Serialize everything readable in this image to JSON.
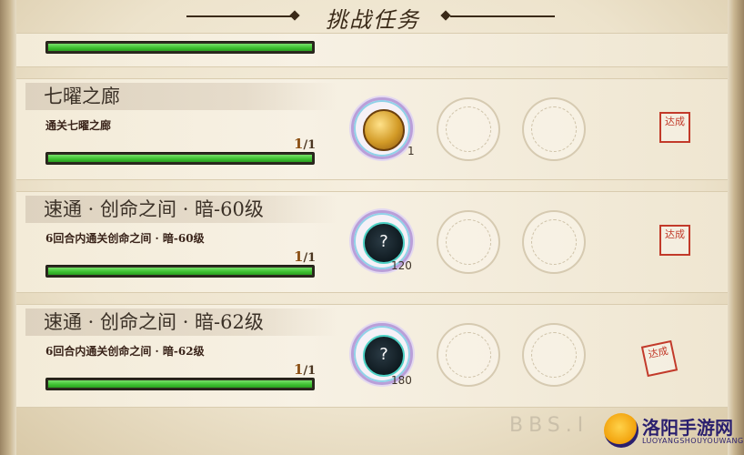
{
  "header": {
    "title": "挑战任务"
  },
  "top_bar": {
    "fill": 1.0
  },
  "missions": [
    {
      "title": "七曜之廊",
      "description": "通关七曜之廊",
      "progress_done": "1",
      "progress_total": "/1",
      "fill": 1.0,
      "reward_type": "coin",
      "reward_count": "1",
      "stamp": "达成"
    },
    {
      "title": "速通 · 创命之间 · 暗-60级",
      "description": "6回合内通关创命之间 · 暗-60级",
      "progress_done": "1",
      "progress_total": "/1",
      "fill": 1.0,
      "reward_type": "mystery",
      "reward_icon": "?",
      "reward_count": "120",
      "stamp": "达成"
    },
    {
      "title": "速通 · 创命之间 · 暗-62级",
      "description": "6回合内通关创命之间 · 暗-62级",
      "progress_done": "1",
      "progress_total": "/1",
      "fill": 1.0,
      "reward_type": "mystery",
      "reward_icon": "?",
      "reward_count": "180",
      "stamp": "达成"
    }
  ],
  "watermark": "BBS.I",
  "brand": {
    "name": "洛阳手游网",
    "sub": "LUOYANGSHOUYOUWANG"
  }
}
